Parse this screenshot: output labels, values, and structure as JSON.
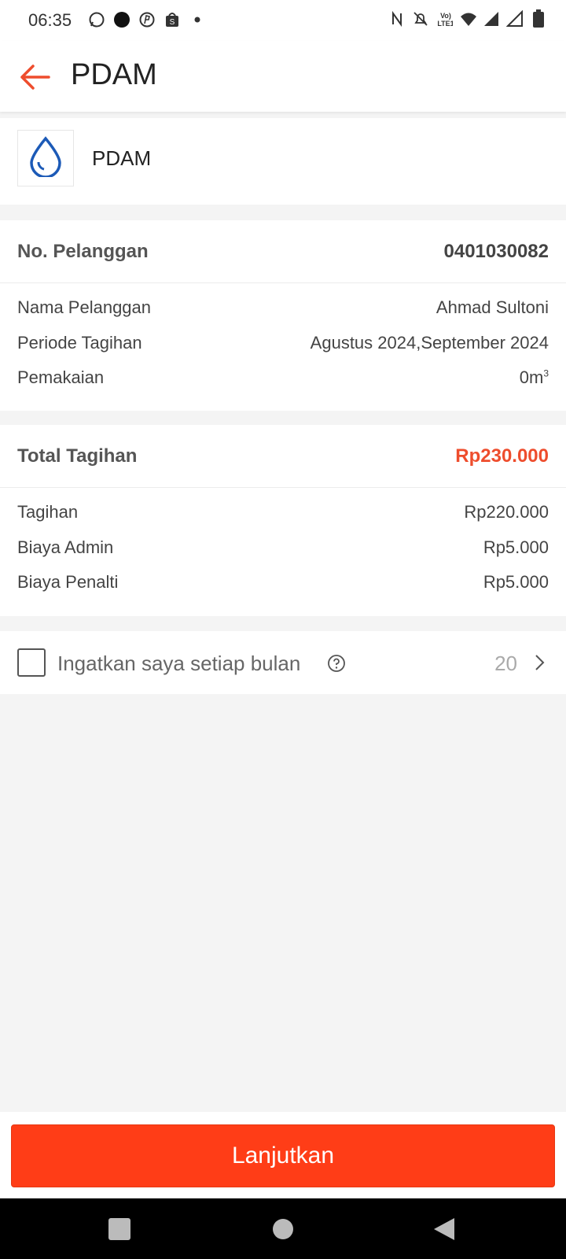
{
  "status_bar": {
    "time": "06:35",
    "left_icons": [
      "whatsapp-icon",
      "circle-icon",
      "p-icon",
      "shopee-icon",
      "dot-icon"
    ],
    "right_icons": [
      "nfc-icon",
      "mute-icon",
      "volte-icon",
      "wifi-icon",
      "signal-icon",
      "signal-icon",
      "battery-icon"
    ]
  },
  "app_bar": {
    "title": "PDAM",
    "accent_color": "#ee4d2d"
  },
  "provider": {
    "name": "PDAM",
    "icon": "water-drop-icon"
  },
  "customer": {
    "id_label": "No. Pelanggan",
    "id_value": "0401030082",
    "name_label": "Nama Pelanggan",
    "name_value": "Ahmad Sultoni",
    "period_label": "Periode Tagihan",
    "period_value": "Agustus 2024,September 2024",
    "usage_label": "Pemakaian",
    "usage_value": "0m",
    "usage_unit_sup": "3"
  },
  "bill": {
    "total_label": "Total Tagihan",
    "total_value": "Rp230.000",
    "items": [
      {
        "label": "Tagihan",
        "value": "Rp220.000"
      },
      {
        "label": "Biaya Admin",
        "value": "Rp5.000"
      },
      {
        "label": "Biaya Penalti",
        "value": "Rp5.000"
      }
    ]
  },
  "reminder": {
    "label": "Ingatkan saya setiap bulan",
    "day": "20",
    "checked": false
  },
  "primary_button": {
    "label": "Lanjutkan",
    "color": "#ff3d17"
  }
}
